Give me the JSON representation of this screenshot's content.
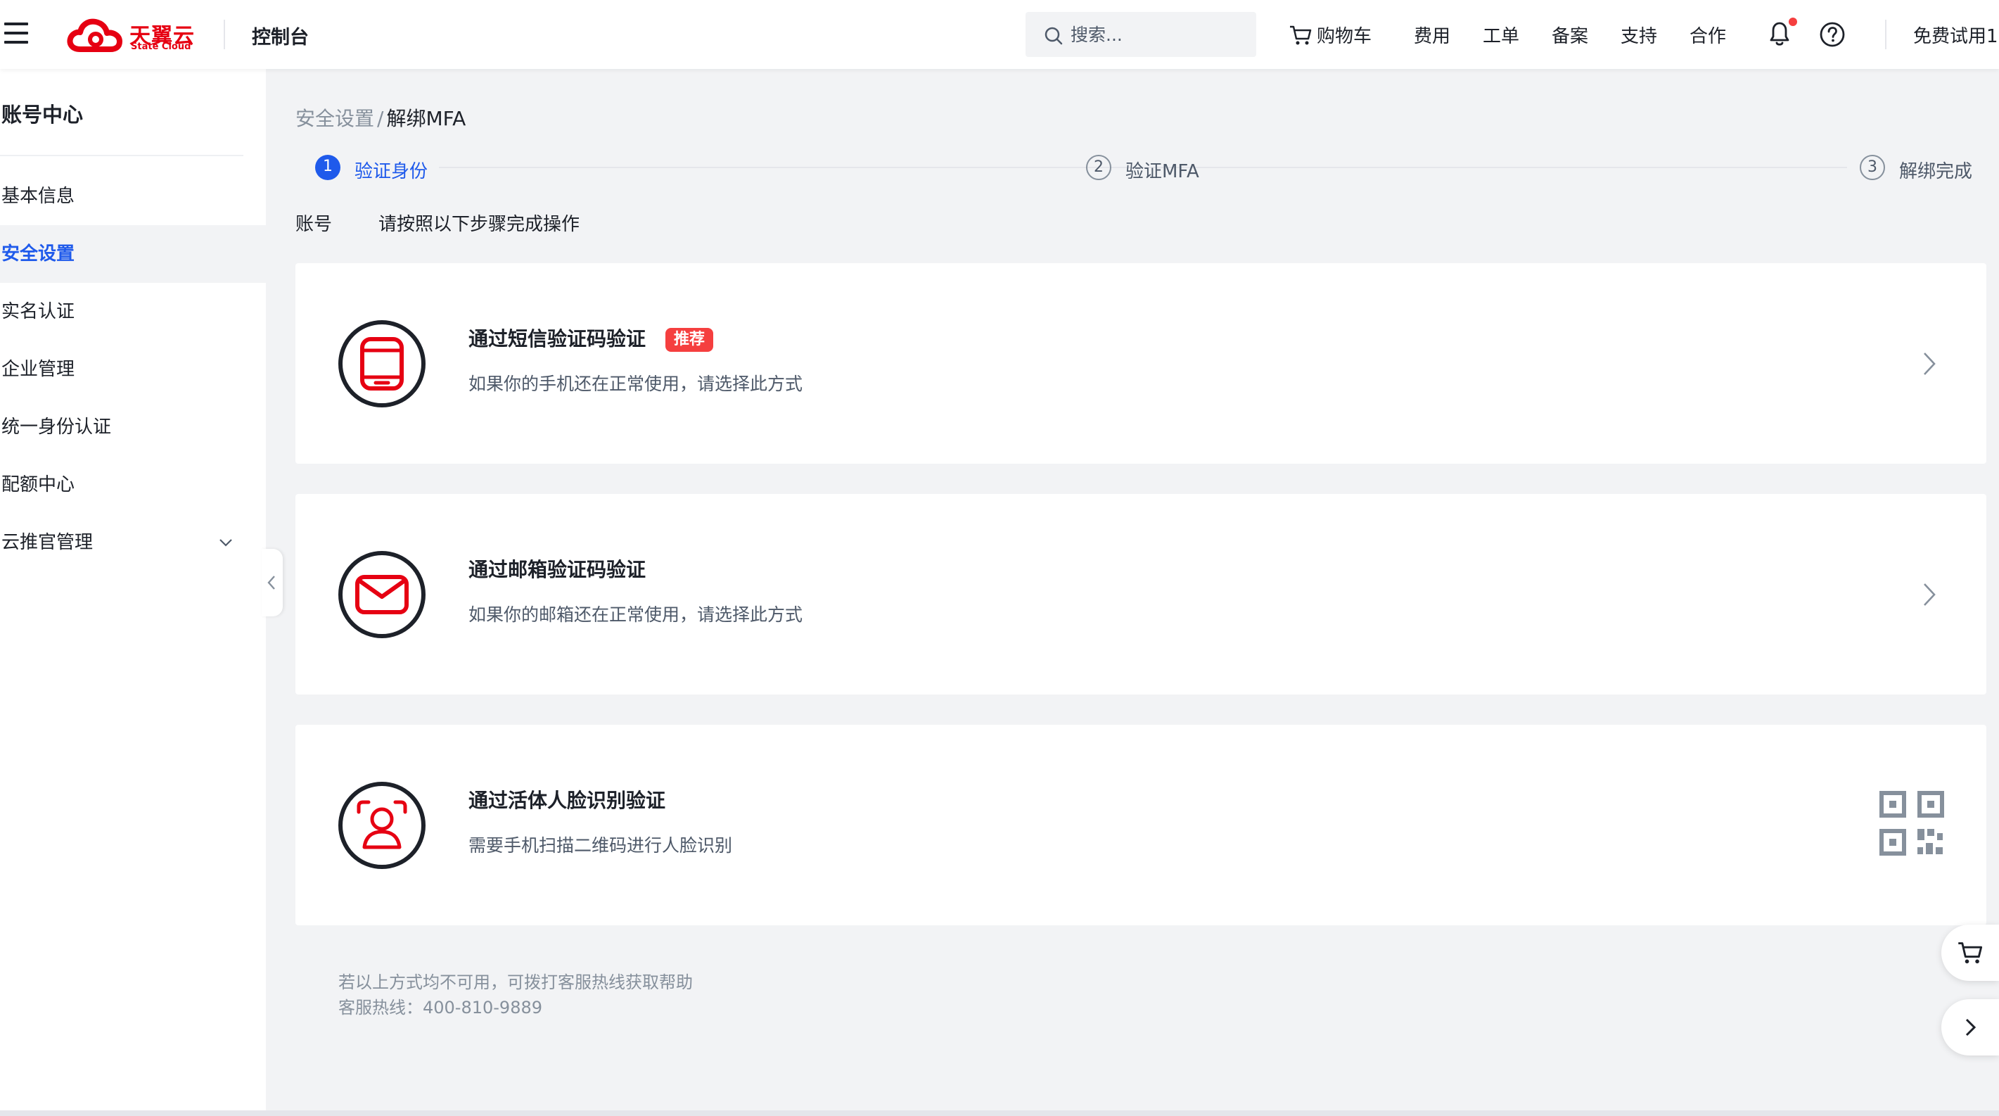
{
  "header": {
    "logo_cn": "天翼云",
    "logo_en": "State Cloud",
    "console_title": "控制台",
    "search_placeholder": "搜索...",
    "nav": {
      "cart": "购物车",
      "fees": "费用",
      "tickets": "工单",
      "filing": "备案",
      "support": "支持",
      "cooperation": "合作",
      "free_trial": "免费试用1"
    }
  },
  "sidebar": {
    "title": "账号中心",
    "items": [
      {
        "label": "基本信息"
      },
      {
        "label": "安全设置"
      },
      {
        "label": "实名认证"
      },
      {
        "label": "企业管理"
      },
      {
        "label": "统一身份认证"
      },
      {
        "label": "配额中心"
      },
      {
        "label": "云推官管理"
      }
    ],
    "active_index": 1
  },
  "breadcrumb": {
    "parent": "安全设置",
    "separator": "/",
    "current": "解绑MFA"
  },
  "steps": [
    {
      "number": "1",
      "label": "验证身份",
      "state": "active"
    },
    {
      "number": "2",
      "label": "验证MFA",
      "state": "pending"
    },
    {
      "number": "3",
      "label": "解绑完成",
      "state": "pending"
    }
  ],
  "account": {
    "label": "账号",
    "hint": "请按照以下步骤完成操作"
  },
  "methods": [
    {
      "title": "通过短信验证码验证",
      "badge": "推荐",
      "desc": "如果你的手机还在正常使用，请选择此方式",
      "icon": "phone-icon"
    },
    {
      "title": "通过邮箱验证码验证",
      "desc": "如果你的邮箱还在正常使用，请选择此方式",
      "icon": "mail-icon"
    },
    {
      "title": "通过活体人脸识别验证",
      "desc": "需要手机扫描二维码进行人脸识别",
      "icon": "face-icon"
    }
  ],
  "help": {
    "line1": "若以上方式均不可用，可拨打客服热线获取帮助",
    "line2": "客服热线：400-810-9889"
  },
  "colors": {
    "brand_red": "#e60012",
    "accent_blue": "#1f5aeb",
    "badge_red": "#f53f3f"
  }
}
